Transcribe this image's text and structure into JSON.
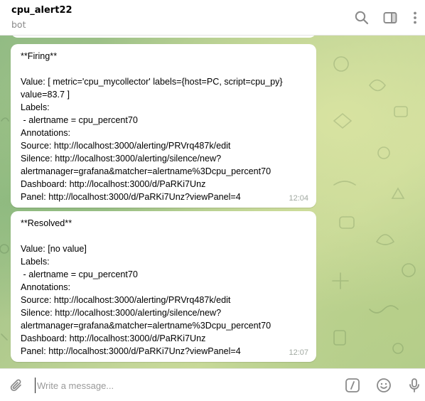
{
  "header": {
    "title": "cpu_alert22",
    "subtitle": "bot",
    "icons": [
      "search-icon",
      "sidebar-toggle-icon",
      "more-vert-icon"
    ]
  },
  "messages": [
    {
      "lines": [
        "**Firing**",
        "",
        "Value: [ metric='cpu_mycollector' labels={host=PC, script=cpu_py}",
        "value=83.7 ]",
        "Labels:",
        " - alertname = cpu_percent70",
        "Annotations:",
        "Source: http://localhost:3000/alerting/PRVrq487k/edit",
        "Silence: http://localhost:3000/alerting/silence/new?",
        "alertmanager=grafana&matcher=alertname%3Dcpu_percent70",
        "Dashboard: http://localhost:3000/d/PaRKi7Unz",
        "Panel: http://localhost:3000/d/PaRKi7Unz?viewPanel=4"
      ],
      "time": "12:04"
    },
    {
      "lines": [
        "**Resolved**",
        "",
        "Value: [no value]",
        "Labels:",
        " - alertname = cpu_percent70",
        "Annotations:",
        "Source: http://localhost:3000/alerting/PRVrq487k/edit",
        "Silence: http://localhost:3000/alerting/silence/new?",
        "alertmanager=grafana&matcher=alertname%3Dcpu_percent70",
        "Dashboard: http://localhost:3000/d/PaRKi7Unz",
        "Panel: http://localhost:3000/d/PaRKi7Unz?viewPanel=4"
      ],
      "time": "12:07"
    }
  ],
  "composer": {
    "placeholder": "Write a message...",
    "icons": [
      "attach-icon",
      "bot-command-icon",
      "emoji-icon",
      "microphone-icon"
    ]
  },
  "colors": {
    "bubble": "#ffffff",
    "time_text": "#a0a8a0",
    "icon_gray": "#8a8a8a",
    "wallpaper": "#a8c68a"
  }
}
